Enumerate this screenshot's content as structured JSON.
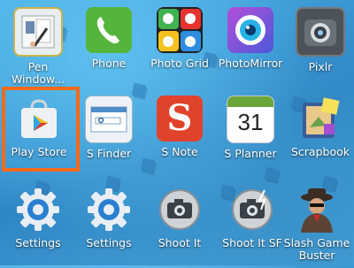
{
  "apps": [
    {
      "label": "Pen Window...",
      "icon": "pen-window-icon"
    },
    {
      "label": "Phone",
      "icon": "phone-icon"
    },
    {
      "label": "Photo Grid",
      "icon": "photo-grid-icon"
    },
    {
      "label": "PhotoMirror",
      "icon": "photomirror-icon"
    },
    {
      "label": "Pixlr",
      "icon": "pixlr-icon"
    },
    {
      "label": "Play Store",
      "icon": "play-store-icon"
    },
    {
      "label": "S Finder",
      "icon": "s-finder-icon"
    },
    {
      "label": "S Note",
      "icon": "s-note-icon"
    },
    {
      "label": "S Planner",
      "icon": "s-planner-icon"
    },
    {
      "label": "Scrapbook",
      "icon": "scrapbook-icon"
    },
    {
      "label": "Settings",
      "icon": "settings-gear-icon"
    },
    {
      "label": "Settings",
      "icon": "settings-gear-icon"
    },
    {
      "label": "Shoot It",
      "icon": "camera-icon"
    },
    {
      "label": "Shoot It SF",
      "icon": "camera-icon"
    },
    {
      "label": "Slash Game Buster",
      "icon": "slash-game-buster-icon"
    }
  ],
  "s_planner_day": "31",
  "s_note_letter": "S",
  "highlight_color": "#f26a1b"
}
